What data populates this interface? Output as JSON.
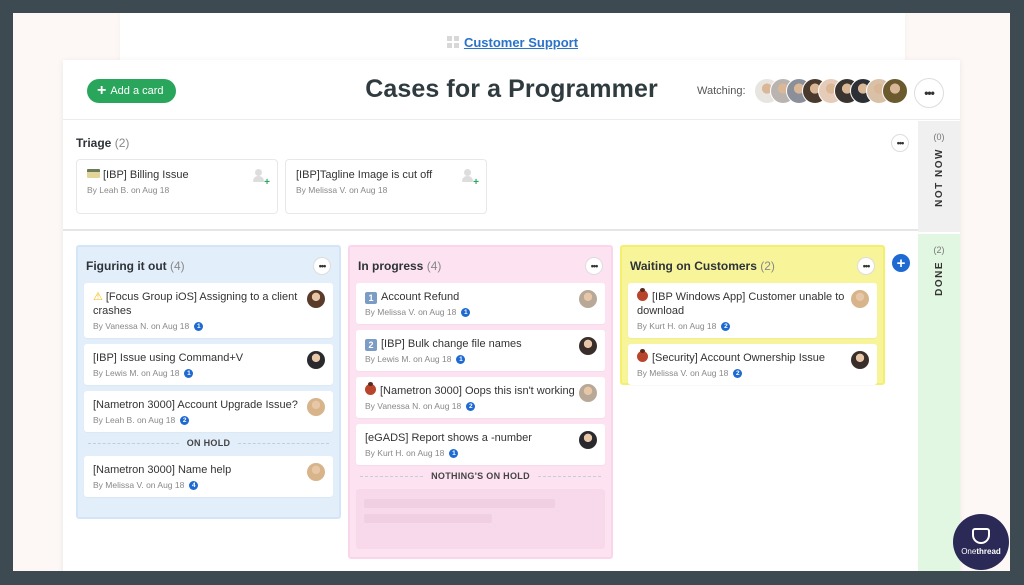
{
  "breadcrumb": {
    "label": "Customer Support",
    "icon": "grid-icon"
  },
  "header": {
    "add_card_label": "Add a card",
    "title": "Cases for a Programmer",
    "watching_label": "Watching:",
    "watcher_count": 9,
    "watcher_colors": [
      "#e8e4e0",
      "#b9b4b0",
      "#8a8f9a",
      "#4a3a2e",
      "#e5cbb8",
      "#3a3430",
      "#2c3035",
      "#d9c1a8",
      "#6a5a2e"
    ]
  },
  "triage": {
    "title": "Triage",
    "count": "(2)",
    "cards": [
      {
        "title": "[IBP] Billing Issue",
        "meta": "By Leah B. on Aug 18",
        "icon": "credit-card-icon"
      },
      {
        "title": "[IBP]Tagline Image is cut off",
        "meta": "By Melissa V. on Aug 18"
      }
    ]
  },
  "side_lanes": {
    "not_now": {
      "label": "NOT NOW",
      "count": "(0)",
      "color": "#f0f0f0"
    },
    "done": {
      "label": "DONE",
      "count": "(2)",
      "color": "#e2f7e1"
    }
  },
  "columns": [
    {
      "title": "Figuring it out",
      "count": "(4)",
      "color": "#e3eefb",
      "cards": [
        {
          "icon": "warning-icon",
          "title": "[Focus Group iOS] Assigning to a client crashes",
          "meta": "By Vanessa N. on Aug 18",
          "badge": "1",
          "avatar": "#5a3a28"
        },
        {
          "title": "[IBP] Issue using Command+V",
          "meta": "By Lewis M. on Aug 18",
          "badge": "1",
          "avatar": "#2a2a2e"
        },
        {
          "title": "[Nametron 3000] Account Upgrade Issue?",
          "meta": "By Leah B. on Aug 18",
          "badge": "2",
          "avatar": "#d7b48a"
        }
      ],
      "hold_label": "ON HOLD",
      "hold_cards": [
        {
          "title": "[Nametron 3000] Name help",
          "meta": "By Melissa V. on Aug 18",
          "badge": "4",
          "avatar": "#d7b48a"
        }
      ]
    },
    {
      "title": "In progress",
      "count": "(4)",
      "color": "#fde3f2",
      "cards": [
        {
          "icon": "number-1-icon",
          "icon_text": "1",
          "title": "Account Refund",
          "meta": "By Melissa V. on Aug 18",
          "badge": "1",
          "avatar": "#b8a898"
        },
        {
          "icon": "number-2-icon",
          "icon_text": "2",
          "title": "[IBP] Bulk change file names",
          "meta": "By Lewis M. on Aug 18",
          "badge": "1",
          "avatar": "#3a2e2a"
        },
        {
          "icon": "bug-icon",
          "title": "[Nametron 3000] Oops this isn't working",
          "meta": "By Vanessa N. on Aug 18",
          "badge": "2",
          "avatar": "#b8a898"
        },
        {
          "title": "[eGADS] Report shows a -number",
          "meta": "By Kurt H. on Aug 18",
          "badge": "1",
          "avatar": "#2a2a2e"
        }
      ],
      "hold_label": "NOTHING'S ON HOLD"
    },
    {
      "title": "Waiting on Customers",
      "count": "(2)",
      "color": "#f8f49a",
      "cards": [
        {
          "icon": "bug-icon",
          "title": "[IBP Windows App] Customer unable to download",
          "meta": "By Kurt H. on Aug 18",
          "badge": "2",
          "avatar": "#d7b48a"
        },
        {
          "icon": "bug-icon",
          "title": "[Security] Account Ownership Issue",
          "meta": "By Melissa V. on Aug 18",
          "badge": "2",
          "avatar": "#3a2e2a"
        }
      ]
    }
  ],
  "brand": {
    "name_light": "One",
    "name_bold": "thread"
  },
  "colors": {
    "accent_green": "#2aa65c",
    "accent_blue": "#1e6ad2",
    "link": "#2a73c9"
  }
}
